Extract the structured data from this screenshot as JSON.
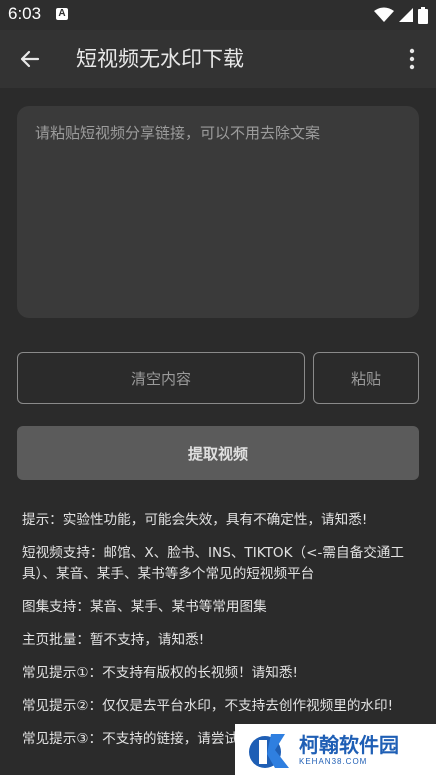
{
  "status_bar": {
    "time": "6:03",
    "notification_icon": "A"
  },
  "app_bar": {
    "title": "短视频无水印下载"
  },
  "input": {
    "placeholder": "请粘贴短视频分享链接，可以不用去除文案"
  },
  "buttons": {
    "clear": "清空内容",
    "paste": "粘贴",
    "extract": "提取视频"
  },
  "tips": [
    "提示：实验性功能，可能会失效，具有不确定性，请知悉!",
    "短视频支持：邮馆、X、脸书、INS、TIKTOK（<-需自备交通工具）、某音、某手、某书等多个常见的短视频平台",
    "图集支持：某音、某手、某书等常用图集",
    "主页批量：暂不支持，请知悉!",
    "常见提示①：不支持有版权的长视频！请知悉!",
    "常见提示②：仅仅是去平台水印，不支持去创作视频里的水印!",
    "常见提示③：不支持的链接，请尝试"
  ],
  "watermark": {
    "name": "柯翰软件园",
    "domain": "KEHAN38.COM"
  },
  "colors": {
    "background": "#2b2b2b",
    "app_bar": "#333333",
    "input_bg": "#3a3a3a",
    "extract_btn": "#5b5b5b",
    "watermark_blue": "#1f5fb5"
  }
}
